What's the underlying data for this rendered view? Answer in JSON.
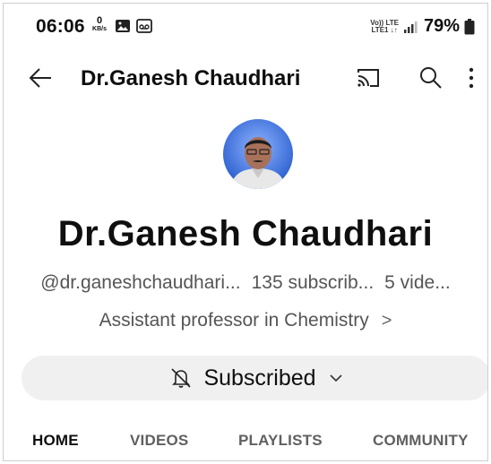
{
  "status_bar": {
    "time": "06:06",
    "net_speed_value": "0",
    "net_speed_unit": "KB/s",
    "network_line1": "Vo)) LTE",
    "network_line2": "LTE1 ↓↑",
    "battery": "79%",
    "icons": [
      "gallery-icon",
      "voicemail-icon",
      "signal-icon",
      "battery-icon"
    ]
  },
  "appbar": {
    "title": "Dr.Ganesh Chaudhari",
    "icons": [
      "back-arrow-icon",
      "cast-icon",
      "search-icon",
      "more-vert-icon"
    ]
  },
  "channel": {
    "name": "Dr.Ganesh Chaudhari",
    "handle": "@dr.ganeshchaudhari...",
    "subscribers": "135 subscrib...",
    "videos": "5 vide...",
    "description": "Assistant professor in Chemistry",
    "description_chevron": ">"
  },
  "subscribe_button": {
    "label": "Subscribed",
    "icon": "bell-off-icon",
    "dropdown_icon": "chevron-down-icon"
  },
  "tabs": [
    {
      "label": "HOME",
      "active": true
    },
    {
      "label": "VIDEOS",
      "active": false
    },
    {
      "label": "PLAYLISTS",
      "active": false
    },
    {
      "label": "COMMUNITY",
      "active": false
    }
  ],
  "colors": {
    "text_primary": "#0f0f0f",
    "text_secondary": "#606060",
    "button_bg": "#f0f0f0",
    "avatar_bg": "#3a6fd8"
  }
}
